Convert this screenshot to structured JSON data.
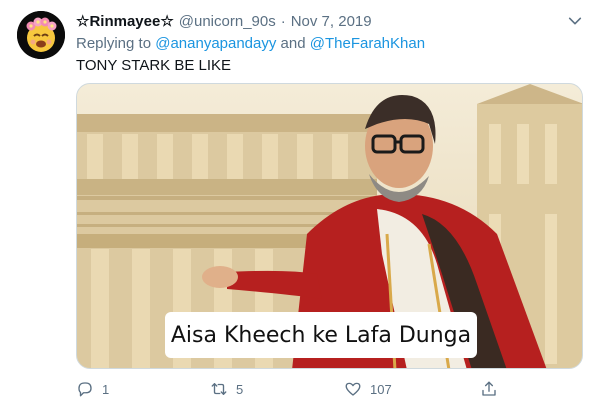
{
  "tweet": {
    "display_name": "☆Rinmayee☆",
    "handle": "@unicorn_90s",
    "separator": "·",
    "date": "Nov 7, 2019",
    "replying_prefix": "Replying to",
    "replying_to": [
      "@ananyapandayy",
      "@TheFarahKhan"
    ],
    "replying_joiner": "and",
    "text": "TONY STARK BE LIKE",
    "media": {
      "caption": "Aisa Kheech ke Lafa Dunga"
    },
    "actions": {
      "reply_count": "1",
      "retweet_count": "5",
      "like_count": "107"
    }
  },
  "icons": {
    "avatar": "flower-crown-emoji-avatar",
    "caret": "chevron-down-icon",
    "reply": "reply-bubble-icon",
    "retweet": "retweet-arrows-icon",
    "like": "heart-icon",
    "share": "share-upload-icon"
  },
  "colors": {
    "link": "#1b95e0",
    "secondary_text": "#5b7083",
    "primary_text": "#0f1419"
  }
}
